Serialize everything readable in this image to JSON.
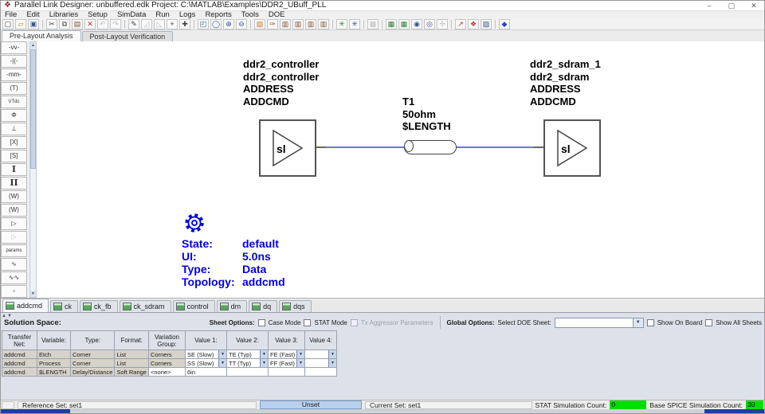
{
  "window": {
    "title": "Parallel Link Designer: unbuffered.edk Project: C:\\MATLAB\\Examples\\DDR2_UBuff_PLL",
    "minimize": "–",
    "maximize": "▢",
    "close": "✕"
  },
  "menu": {
    "items": [
      "File",
      "Edit",
      "Libraries",
      "Setup",
      "SimData",
      "Run",
      "Logs",
      "Reports",
      "Tools",
      "DOE"
    ]
  },
  "toolbar": {
    "icons": [
      {
        "name": "new-icon",
        "g": "▢"
      },
      {
        "name": "open-icon",
        "g": "▱"
      },
      {
        "name": "save-icon",
        "g": "▣"
      },
      {
        "name": "cut-icon",
        "g": "✂"
      },
      {
        "name": "copy-icon",
        "g": "⧉"
      },
      {
        "name": "paste-icon",
        "g": "▤"
      },
      {
        "name": "delete-icon",
        "g": "✕"
      },
      {
        "name": "undo-icon",
        "g": "↶"
      },
      {
        "name": "redo-icon",
        "g": "↷"
      },
      {
        "name": "draw-wire-icon",
        "g": "✎"
      },
      {
        "name": "route-a-icon",
        "g": "◿"
      },
      {
        "name": "route-b-icon",
        "g": "◺"
      },
      {
        "name": "crosshair-icon",
        "g": "+"
      },
      {
        "name": "pan-icon",
        "g": "✚"
      },
      {
        "name": "zoom-window-icon",
        "g": "◰"
      },
      {
        "name": "zoom-full-icon",
        "g": "◯"
      },
      {
        "name": "zoom-in-icon",
        "g": "⊕"
      },
      {
        "name": "zoom-out-icon",
        "g": "⊖"
      },
      {
        "name": "sheet-setup-icon",
        "g": "▧"
      },
      {
        "name": "pin-edit-icon",
        "g": "✑"
      },
      {
        "name": "library-1-icon",
        "g": "▥"
      },
      {
        "name": "library-2-icon",
        "g": "▥"
      },
      {
        "name": "library-3-icon",
        "g": "▥"
      },
      {
        "name": "library-4-icon",
        "g": "▥"
      },
      {
        "name": "sim-settings-icon",
        "g": "✳"
      },
      {
        "name": "run-simulation-icon",
        "g": "✳"
      },
      {
        "name": "export-icon",
        "g": "▩"
      },
      {
        "name": "waveform-viewer-icon",
        "g": "▦"
      },
      {
        "name": "board-view-icon",
        "g": "▦"
      },
      {
        "name": "view-results-icon",
        "g": "◉"
      },
      {
        "name": "view-report-icon",
        "g": "◎"
      },
      {
        "name": "fit-view-icon",
        "g": "✢"
      },
      {
        "name": "plot-icon",
        "g": "↗"
      },
      {
        "name": "stimulus-icon",
        "g": "❖"
      },
      {
        "name": "doe-sheet-icon",
        "g": "▨"
      },
      {
        "name": "help-icon",
        "g": "◆"
      }
    ]
  },
  "modetabs": {
    "pre": "Pre-Layout Analysis",
    "post": "Post-Layout Verification"
  },
  "palette": {
    "tools": [
      {
        "name": "resistor-tool",
        "g": "-vv-"
      },
      {
        "name": "capacitor-tool",
        "g": "-|(-"
      },
      {
        "name": "inductor-tool",
        "g": "-mm-"
      },
      {
        "name": "t-element-tool",
        "g": "(T)"
      },
      {
        "name": "vt-dc-tool",
        "g": "VTdc"
      },
      {
        "name": "probe-tool",
        "g": "Φ"
      },
      {
        "name": "ground-tool",
        "g": "⊥"
      },
      {
        "name": "x-element-tool",
        "g": "[X]"
      },
      {
        "name": "s-element-tool",
        "g": "[S]"
      },
      {
        "name": "tline-tool",
        "g": "I"
      },
      {
        "name": "coupled-tline-tool",
        "g": "II"
      },
      {
        "name": "w-element-tool",
        "g": "(W)"
      },
      {
        "name": "w-element-2-tool",
        "g": "(W)"
      },
      {
        "name": "buffer-tool",
        "g": "▷"
      },
      {
        "name": "buffer-disabled-tool",
        "g": "▷"
      },
      {
        "name": "params-tool",
        "g": "params"
      },
      {
        "name": "probe-single-tool",
        "g": "∿"
      },
      {
        "name": "probe-multi-tool",
        "g": "∿∿"
      },
      {
        "name": "more-tool",
        "g": "▫"
      }
    ]
  },
  "schematic": {
    "tx_label": "ddr2_controller\nddr2_controller\nADDRESS\nADDCMD",
    "rx_label": "ddr2_sdram_1\nddr2_sdram\nADDRESS\nADDCMD",
    "tline_label": "T1\n50ohm\n$LENGTH",
    "buffer_label": "sl",
    "wire_color": "#7070e0",
    "state_color": "#0000e0",
    "state": [
      {
        "label": "State:",
        "value": "default"
      },
      {
        "label": "UI:",
        "value": "5.0ns"
      },
      {
        "label": "Type:",
        "value": "Data"
      },
      {
        "label": "Topology:",
        "value": "addcmd"
      }
    ]
  },
  "sheets": {
    "tabs": [
      "addcmd",
      "ck",
      "ck_fb",
      "ck_sdram",
      "control",
      "dm",
      "dq",
      "dqs"
    ],
    "active": "addcmd"
  },
  "solution": {
    "title": "Solution Space:",
    "sheet_options": {
      "label": "Sheet Options:",
      "case_mode": "Case Mode",
      "stat_mode": "STAT Mode",
      "tx_aggressor": "Tx Aggressor Parameters"
    },
    "global_options": {
      "label": "Global Options:",
      "select_doe": "Select DOE Sheet:",
      "show_on_board": "Show On Board",
      "show_all_sheets": "Show All Sheets"
    },
    "table": {
      "headers": [
        "Transfer\nNet:",
        "Variable:",
        "Type:",
        "Format:",
        "Variation\nGroup:",
        "Value 1:",
        "Value 2:",
        "Value 3:",
        "Value 4:"
      ],
      "rows": [
        {
          "net": "addcmd",
          "variable": "Etch",
          "type": "Corner",
          "format": "List",
          "group": "Corners",
          "v1": "SE (Slow)",
          "v2": "TE (Typ)",
          "v3": "FE (Fast)",
          "v4": ""
        },
        {
          "net": "addcmd",
          "variable": "Process",
          "type": "Corner",
          "format": "List",
          "group": "Corners",
          "v1": "SS (Slow)",
          "v2": "TT (Typ)",
          "v3": "FF (Fast)",
          "v4": ""
        },
        {
          "net": "addcmd",
          "variable": "$LENGTH",
          "type": "Delay/Distance",
          "format": "Soft Range",
          "group": "<none>",
          "v1": "6in",
          "v2": "",
          "v3": "",
          "v4": ""
        }
      ]
    }
  },
  "status": {
    "reference": "Reference Set: set1",
    "unset": "Unset",
    "current": "Current Set: set1",
    "stat_label": "STAT Simulation Count:",
    "stat_value": "0",
    "spice_label": "Base SPICE Simulation Count:",
    "spice_value": "30",
    "count_color": "#00dd00"
  }
}
